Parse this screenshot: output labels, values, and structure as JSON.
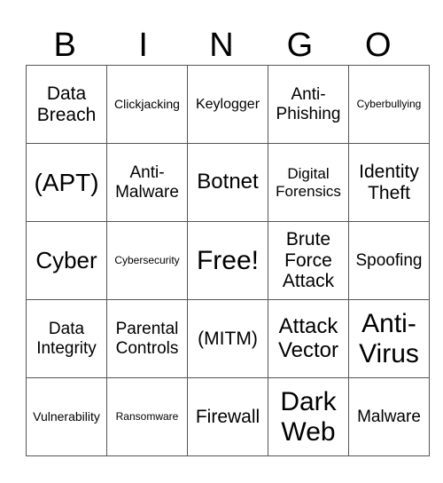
{
  "header": {
    "letters": [
      "B",
      "I",
      "N",
      "G",
      "O"
    ]
  },
  "grid": {
    "rows": [
      [
        {
          "text": "Data Breach",
          "size": "s20"
        },
        {
          "text": "Clickjacking",
          "size": "s12"
        },
        {
          "text": "Keylogger",
          "size": "s14"
        },
        {
          "text": "Anti-Phishing",
          "size": "s18"
        },
        {
          "text": "Cyberbullying",
          "size": "s10"
        }
      ],
      [
        {
          "text": "(APT)",
          "size": "s28"
        },
        {
          "text": "Anti-Malware",
          "size": "s18"
        },
        {
          "text": "Botnet",
          "size": "s24"
        },
        {
          "text": "Digital Forensics",
          "size": "s16"
        },
        {
          "text": "Identity Theft",
          "size": "s20"
        }
      ],
      [
        {
          "text": "Cyber",
          "size": "s26"
        },
        {
          "text": "Cybersecurity",
          "size": "s10"
        },
        {
          "text": "Free!",
          "size": "s30"
        },
        {
          "text": "Brute Force Attack",
          "size": "s20"
        },
        {
          "text": "Spoofing",
          "size": "s18"
        }
      ],
      [
        {
          "text": "Data Integrity",
          "size": "s18"
        },
        {
          "text": "Parental Controls",
          "size": "s18"
        },
        {
          "text": "(MITM)",
          "size": "s20"
        },
        {
          "text": "Attack Vector",
          "size": "s24"
        },
        {
          "text": "Anti-Virus",
          "size": "s30"
        }
      ],
      [
        {
          "text": "Vulnerability",
          "size": "s12"
        },
        {
          "text": "Ransomware",
          "size": "s10"
        },
        {
          "text": "Firewall",
          "size": "s20"
        },
        {
          "text": "Dark Web",
          "size": "s30"
        },
        {
          "text": "Malware",
          "size": "s18"
        }
      ]
    ]
  }
}
